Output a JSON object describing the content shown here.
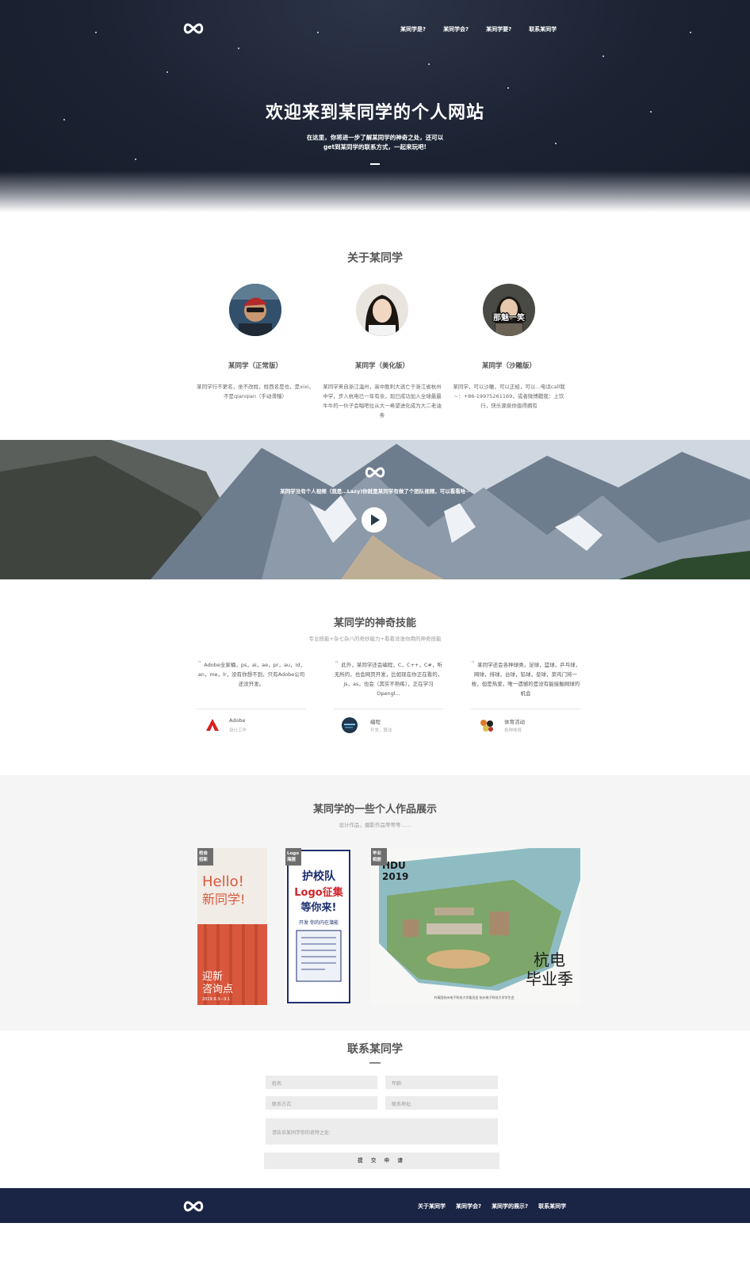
{
  "header": {
    "logo_icon": "infinity-icon",
    "nav": [
      "某同学是?",
      "某同学会?",
      "某同学要?",
      "联系某同学"
    ],
    "title": "欢迎来到某同学的个人网站",
    "subtitle": "在这里，你将进一步了解某同学的神奇之处，还可以get到某同学的联系方式，一起来玩吧!"
  },
  "about": {
    "title": "关于某同学",
    "people": [
      {
        "name": "某同学（正常版）",
        "desc": "某同学行不更名，坐不改姓，姓西名是也，是xixi，不是qianqian（手动滑稽）"
      },
      {
        "name": "某同学（美化版）",
        "desc": "某同学来自浙江温州，高中胜利大逃亡于浙江省杭州中学，步入杭电已一年有余，现已成功加入全球最最牛牛的一伙子会唱吧位从大一希望进化成为大二老油条"
      },
      {
        "name": "某同学（沙雕版）",
        "desc": "某同学，可以沙雕，可以正经，可以…电话call我~：+86-19975261169，或者微博戳我：上饮行，快乐源泉你值得拥有"
      }
    ],
    "avatar3_label": "那魅一笑"
  },
  "banner": {
    "text": "某同学没有个人视频（我是…Lazy)你就是某同学有做了个团队视频，可以看看哈~",
    "play_icon": "play-icon"
  },
  "skills": {
    "title": "某同学的神奇技能",
    "subtitle": "专业技能+杂七杂八的奇妙能力+看看没准你用的神奇技能",
    "items": [
      {
        "quote": "Adobe全家桶，ps，ai，ae，pr，au，id，an，me，lr，没有你想不到，只有Adobe公司还没开发。",
        "name": "Adobe",
        "sub": "设计工作"
      },
      {
        "quote": "此外，某同学还会编程，C，C++，C#，听无所的，也会网页开发，比如现在你正在看的，js，as，也会（其实不熟练），正在学习Opengl...",
        "name": "编程",
        "sub": "开发，算法"
      },
      {
        "quote": "某同学还会各种球类，足球，篮球，乒乓球，网球，排球，台球，铅球，垒球，菜鸡门将一枚，但是热爱，唯一遗憾的是没有能接触网球的机会",
        "name": "体育活动",
        "sub": "各种体育"
      }
    ]
  },
  "works": {
    "title": "某同学的一些个人作品展示",
    "subtitle": "设计作品，摄影作品等等等……",
    "items": [
      {
        "tag": "校会招新",
        "text1": "Hello!",
        "text2": "新同学!",
        "text3": "迎新",
        "text4": "咨询点",
        "date": "2019.9.3—9.1"
      },
      {
        "tag": "Logo海报",
        "text1": "护校队",
        "text2": "Logo征集",
        "text3": "等你来!",
        "text4": "开发 你的内在潜能"
      },
      {
        "tag": "毕业相册",
        "text1": "HDU",
        "text2": "2019",
        "text3": "杭电",
        "text4": "毕业季",
        "caption": "共青团杭州电子科技大学委员会 杭州电子科技大学学生会"
      }
    ]
  },
  "contact": {
    "title": "联系某同学",
    "fields": {
      "name": "姓名:",
      "age": "年龄:",
      "phone": "联系方式:",
      "address": "联系地址:",
      "message": "请告诉某同学你的奇特之处:"
    },
    "submit": "提 交 申 请"
  },
  "footer": {
    "nav": [
      "关于某同学",
      "某同学会?",
      "某同学的展示?",
      "联系某同学"
    ]
  }
}
